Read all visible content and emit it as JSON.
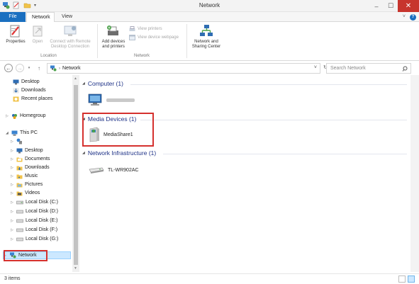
{
  "window": {
    "title": "Network"
  },
  "ribbon_tabs": [
    "File",
    "Network",
    "View"
  ],
  "ribbon": {
    "location": {
      "label": "Location",
      "buttons": [
        {
          "label": "Properties",
          "enabled": true
        },
        {
          "label": "Open",
          "enabled": false
        },
        {
          "label": "Connect with Remote Desktop Connection",
          "enabled": false
        }
      ]
    },
    "network": {
      "label": "Network",
      "buttons": [
        {
          "label": "Add devices and printers",
          "enabled": true
        },
        {
          "label": "View printers",
          "enabled": false
        },
        {
          "label": "View device webpage",
          "enabled": false
        },
        {
          "label": "Network and Sharing Center",
          "enabled": true
        }
      ]
    }
  },
  "address": {
    "path": "Network"
  },
  "search": {
    "placeholder": "Search Network"
  },
  "nav_pane": {
    "quick_access": [
      "Desktop",
      "Downloads",
      "Recent places"
    ],
    "homegroup": "Homegroup",
    "this_pc": "This PC",
    "this_pc_items": [
      "",
      "Desktop",
      "Documents",
      "Downloads",
      "Music",
      "Pictures",
      "Videos",
      "Local Disk (C:)",
      "Local Disk (D:)",
      "Local Disk (E:)",
      "Local Disk (F:)",
      "Local Disk (G:)"
    ],
    "network": "Network"
  },
  "groups": [
    {
      "header": "Computer (1)",
      "items": [
        ""
      ]
    },
    {
      "header": "Media Devices (1)",
      "items": [
        "MediaShare1"
      ]
    },
    {
      "header": "Network Infrastructure (1)",
      "items": [
        "TL-WR902AC"
      ]
    }
  ],
  "status": {
    "count": "3 items"
  },
  "colors": {
    "accent": "#1a6fc0",
    "group_header": "#1e3287",
    "highlight_box": "#d5312e",
    "close_button": "#c7352d"
  }
}
